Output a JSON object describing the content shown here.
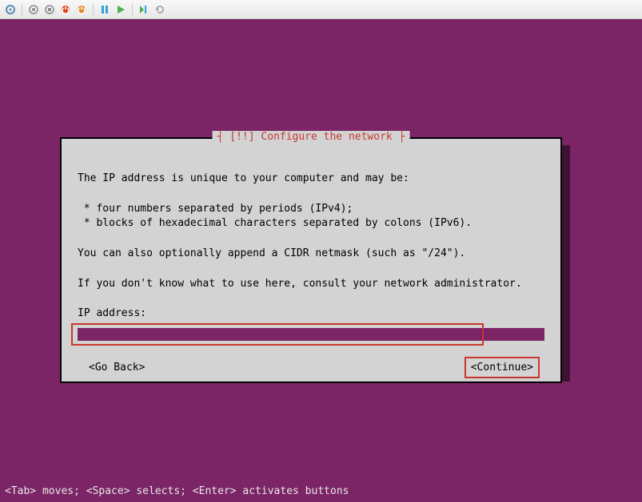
{
  "toolbar": {
    "icons": [
      "settings",
      "record",
      "stop",
      "power-off",
      "power",
      "pause",
      "play",
      "step",
      "reset"
    ]
  },
  "dialog": {
    "title_prefix": "[!!]",
    "title": "Configure the network",
    "line1": "The IP address is unique to your computer and may be:",
    "bullet1": " * four numbers separated by periods (IPv4);",
    "bullet2": " * blocks of hexadecimal characters separated by colons (IPv6).",
    "line2": "You can also optionally append a CIDR netmask (such as \"/24\").",
    "line3": "If you don't know what to use here, consult your network administrator.",
    "field_label": "IP address:",
    "input_value": "",
    "go_back": "<Go Back>",
    "continue": "<Continue>"
  },
  "footer": "<Tab> moves; <Space> selects; <Enter> activates buttons"
}
